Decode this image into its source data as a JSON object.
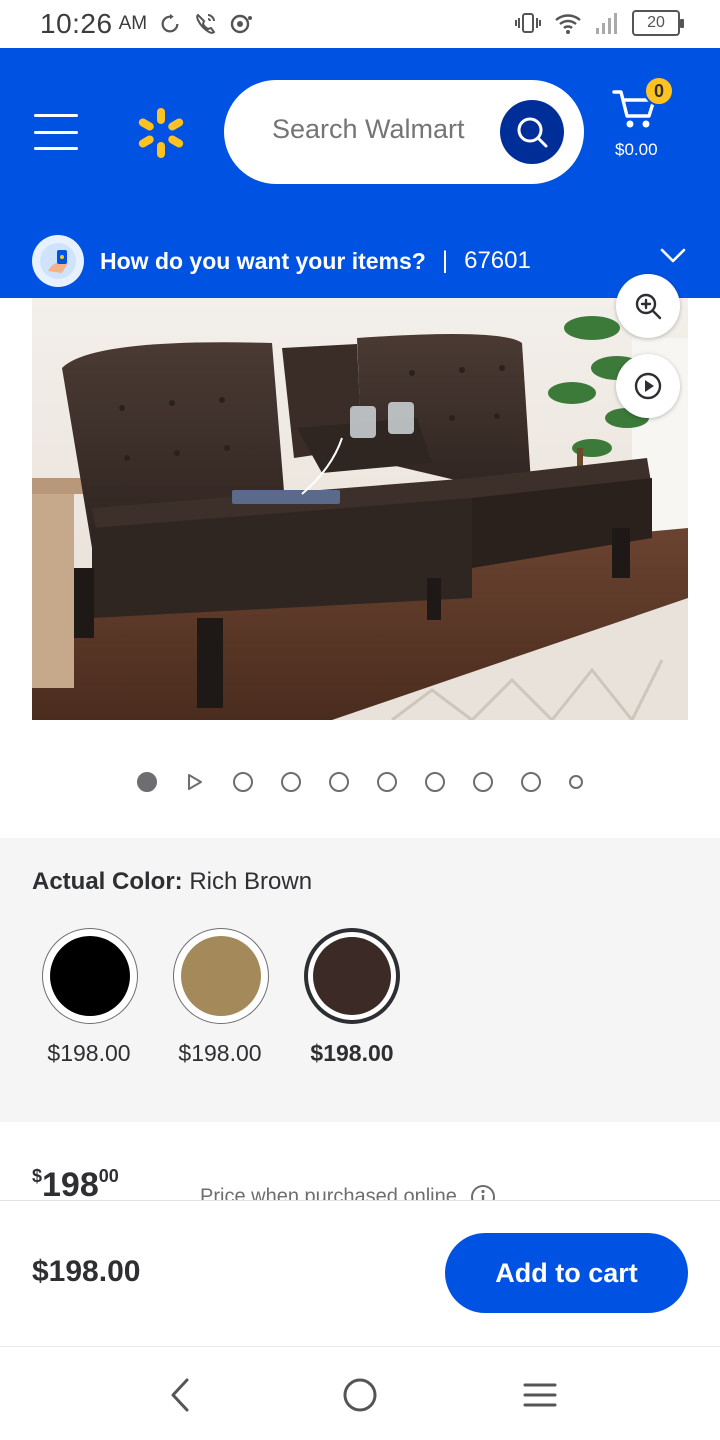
{
  "status_bar": {
    "time": "10:26",
    "ampm": "AM",
    "battery": "20"
  },
  "header": {
    "search_placeholder": "Search Walmart",
    "cart_count": "0",
    "cart_total": "$0.00",
    "delivery_question": "How do you want your items?",
    "delivery_separator": "|",
    "zip_code": "67601"
  },
  "carousel": {
    "dot_count": 10,
    "active_index": 0
  },
  "color": {
    "label": "Actual Color:",
    "selected_name": "Rich Brown",
    "options": [
      {
        "color": "#000000",
        "price": "$198.00",
        "selected": false
      },
      {
        "color": "#a48a5a",
        "price": "$198.00",
        "selected": false
      },
      {
        "color": "#3b2a26",
        "price": "$198.00",
        "selected": true
      }
    ]
  },
  "price": {
    "dollars": "198",
    "currency": "$",
    "cents": "00",
    "note": "Price when purchased online"
  },
  "bottom_bar": {
    "price": "$198.00",
    "add_to_cart_label": "Add to cart"
  },
  "colors": {
    "brand_blue": "#0053e2",
    "spark_yellow": "#ffc220",
    "dark_blue": "#002e99"
  }
}
